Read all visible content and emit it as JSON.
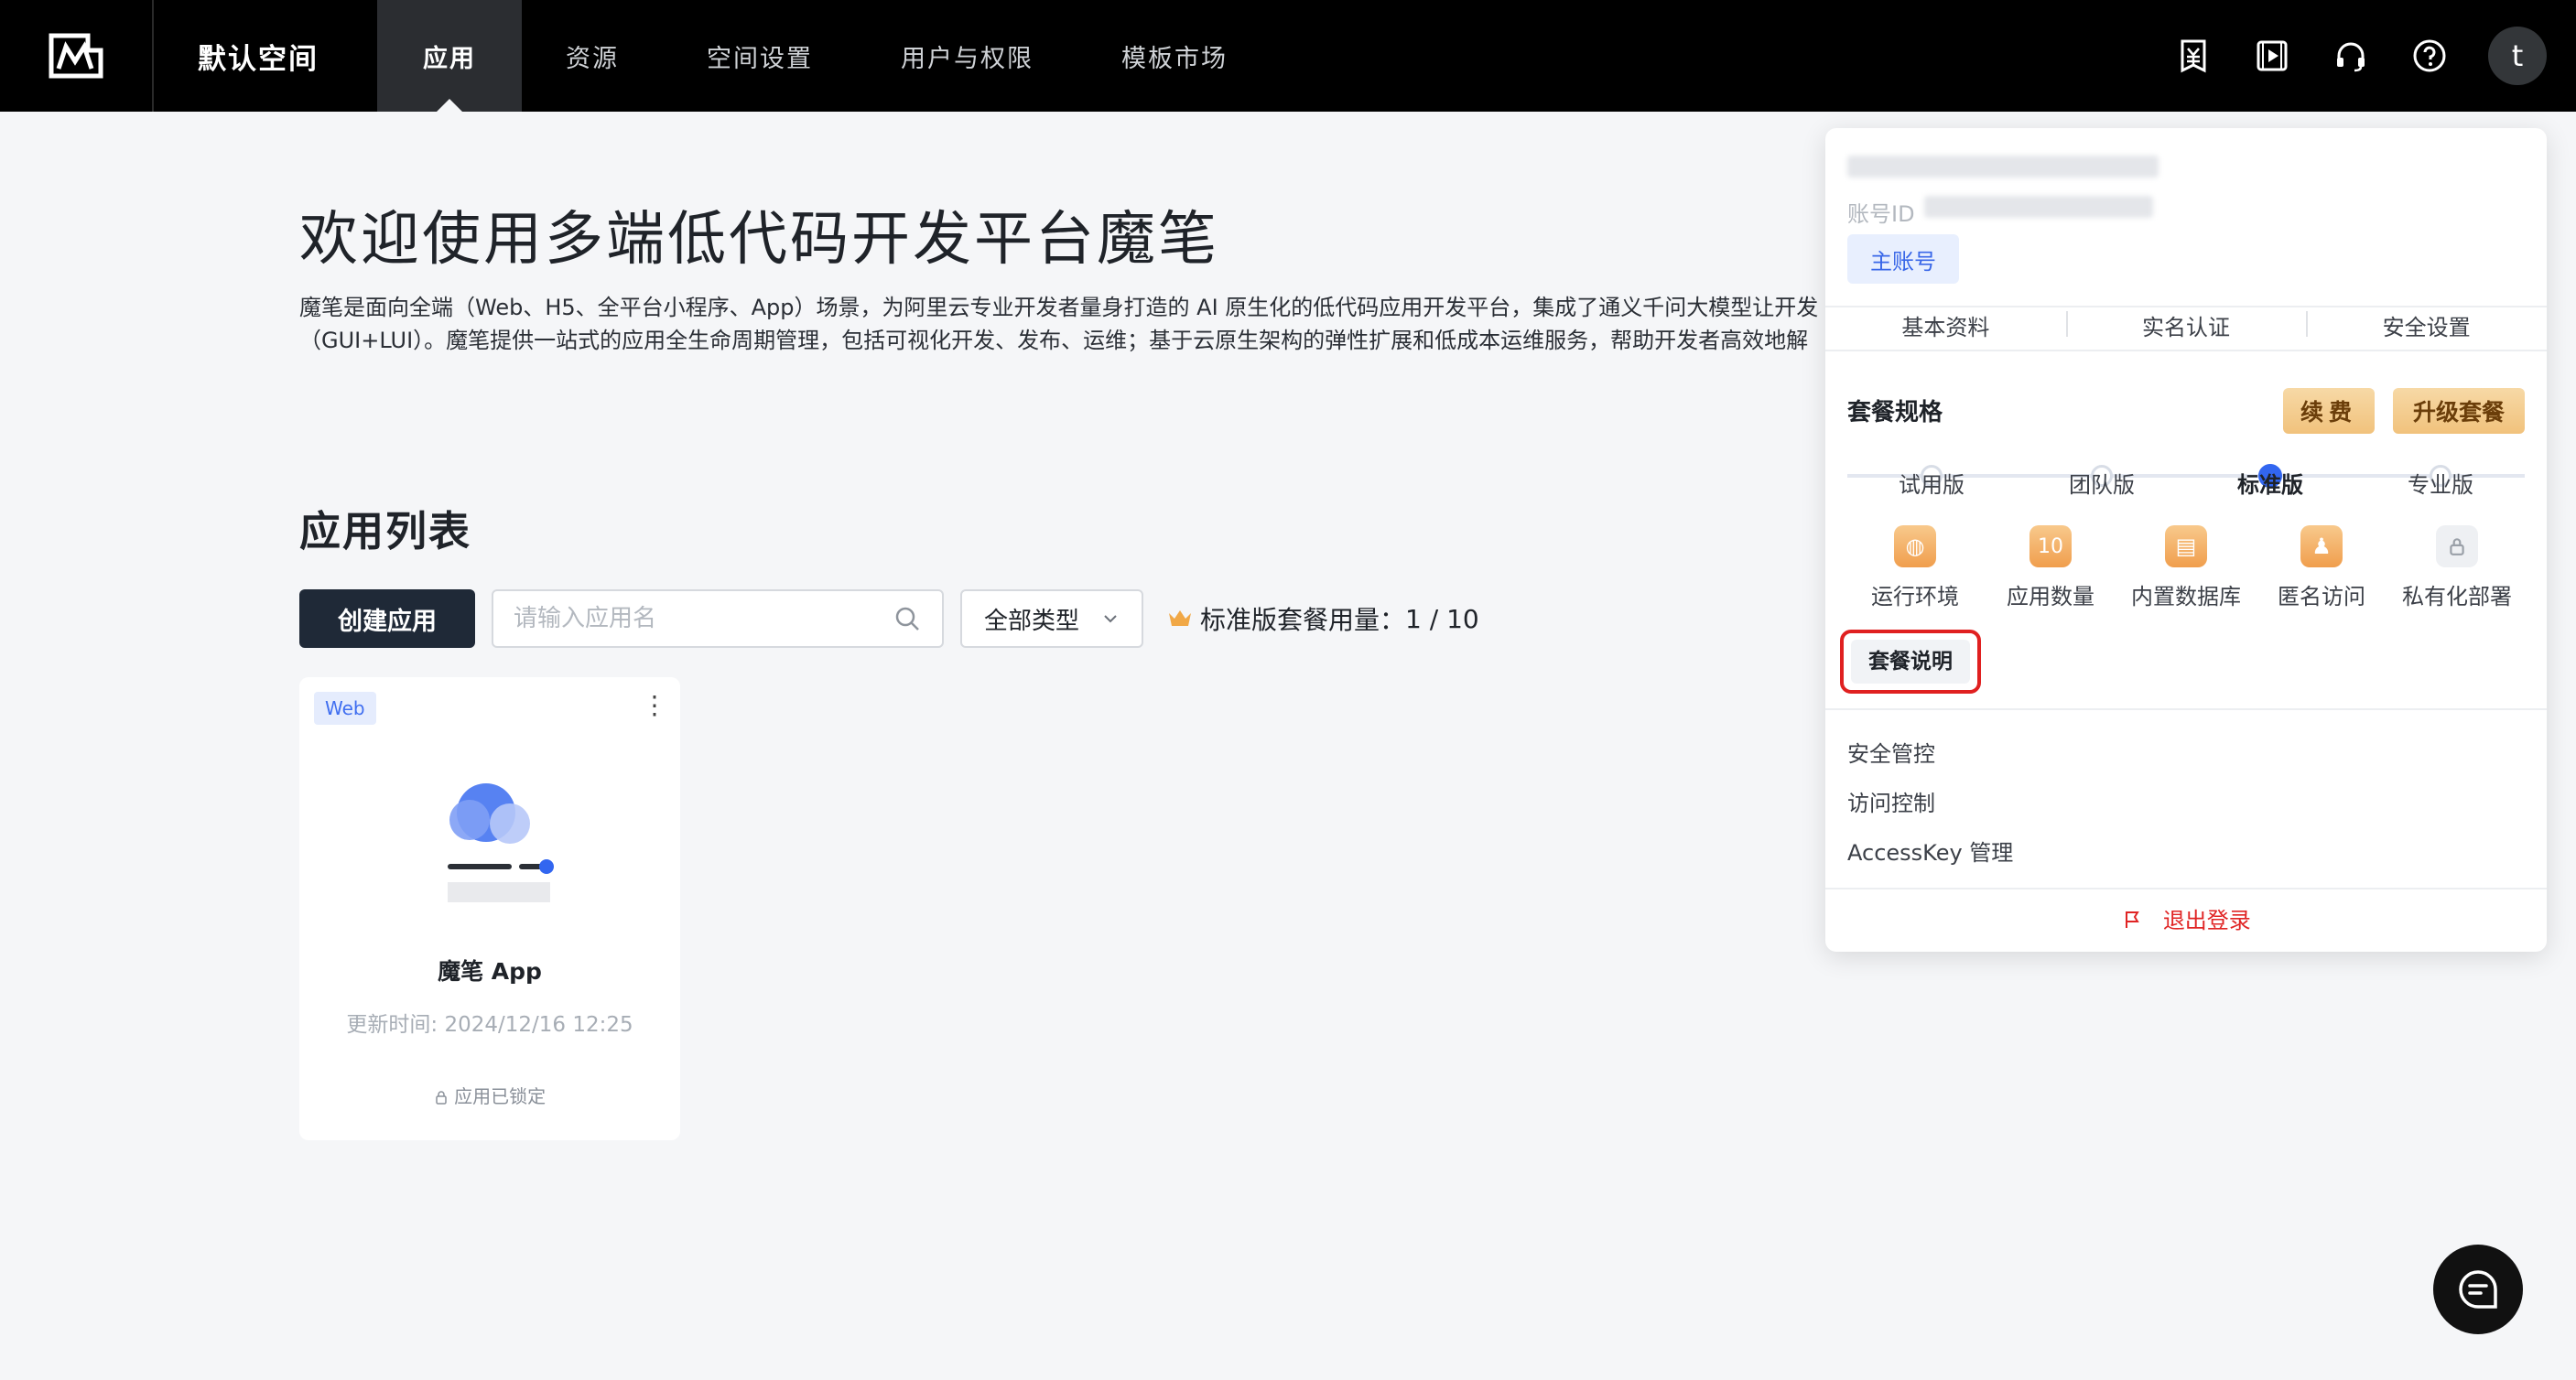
{
  "nav": {
    "workspace": "默认空间",
    "items": [
      {
        "label": "应用",
        "active": true
      },
      {
        "label": "资源"
      },
      {
        "label": "空间设置"
      },
      {
        "label": "用户与权限"
      },
      {
        "label": "模板市场"
      }
    ],
    "icons": [
      "billing-icon",
      "video-icon",
      "headset-icon",
      "help-icon"
    ],
    "avatar": "t"
  },
  "welcome": {
    "title": "欢迎使用多端低代码开发平台魔笔",
    "desc_line1": "魔笔是面向全端（Web、H5、全平台小程序、App）场景，为阿里云专业开发者量身打造的 AI 原生化的低代码应用开发平台，集成了通义千问大模型让开发",
    "desc_line2": "（GUI+LUI）。魔笔提供一站式的应用全生命周期管理，包括可视化开发、发布、运维；基于云原生架构的弹性扩展和低成本运维服务，帮助开发者高效地解"
  },
  "app_list": {
    "title": "应用列表",
    "create_label": "创建应用",
    "search_placeholder": "请输入应用名",
    "type_filter": "全部类型",
    "usage_label": "标准版套餐用量：",
    "usage_value": "1 / 10"
  },
  "card": {
    "tag": "Web",
    "name": "魔笔 App",
    "updated": "更新时间: 2024/12/16 12:25",
    "locked": "应用已锁定"
  },
  "panel": {
    "account_id_label": "账号ID",
    "main_account": "主账号",
    "tabs": [
      "基本资料",
      "实名认证",
      "安全设置"
    ],
    "plan_label": "套餐规格",
    "renew": "续费",
    "upgrade": "升级套餐",
    "plans": [
      "试用版",
      "团队版",
      "标准版",
      "专业版"
    ],
    "active_plan_index": 2,
    "features": [
      {
        "label": "运行环境",
        "icon": "globe-icon",
        "glyph": "◍"
      },
      {
        "label": "应用数量",
        "icon": "count-icon",
        "glyph": "10"
      },
      {
        "label": "内置数据库",
        "icon": "database-icon",
        "glyph": "▤"
      },
      {
        "label": "匿名访问",
        "icon": "user-icon",
        "glyph": "♟"
      },
      {
        "label": "私有化部署",
        "icon": "lock-icon",
        "glyph": "🔒"
      }
    ],
    "plan_explain": "套餐说明",
    "menu": [
      "安全管控",
      "访问控制",
      "AccessKey 管理"
    ],
    "logout": "退出登录"
  }
}
